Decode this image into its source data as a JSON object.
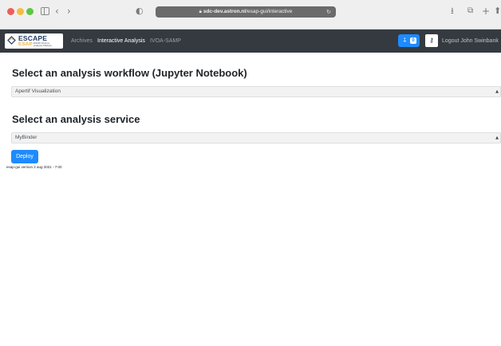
{
  "browser": {
    "url_host": "sdc-dev.astron.nl",
    "url_path": "/esap-gui/interactive"
  },
  "brand": {
    "top": "ESCAPE",
    "bottom": "ESAP",
    "tagline": "ESFRI Science Analysis Platform"
  },
  "nav": {
    "items": [
      {
        "label": "Archives",
        "active": false
      },
      {
        "label": "Interactive Analysis",
        "active": true
      },
      {
        "label": "IVOA-SAMP",
        "active": false
      }
    ],
    "cart_count": "0",
    "logout_label": "Logout John Swinbank"
  },
  "main": {
    "workflow_heading": "Select an analysis workflow (Jupyter Notebook)",
    "workflow_selected": "Apertif Visualization",
    "service_heading": "Select an analysis service",
    "service_selected": "MyBinder",
    "deploy_label": "Deploy",
    "version": "esap-gui version 2 aug 2021 - 7:00"
  },
  "colors": {
    "navbar": "#343a40",
    "primary": "#1e8bff",
    "brand_gold": "#f2b33d",
    "brand_navy": "#213a63"
  }
}
